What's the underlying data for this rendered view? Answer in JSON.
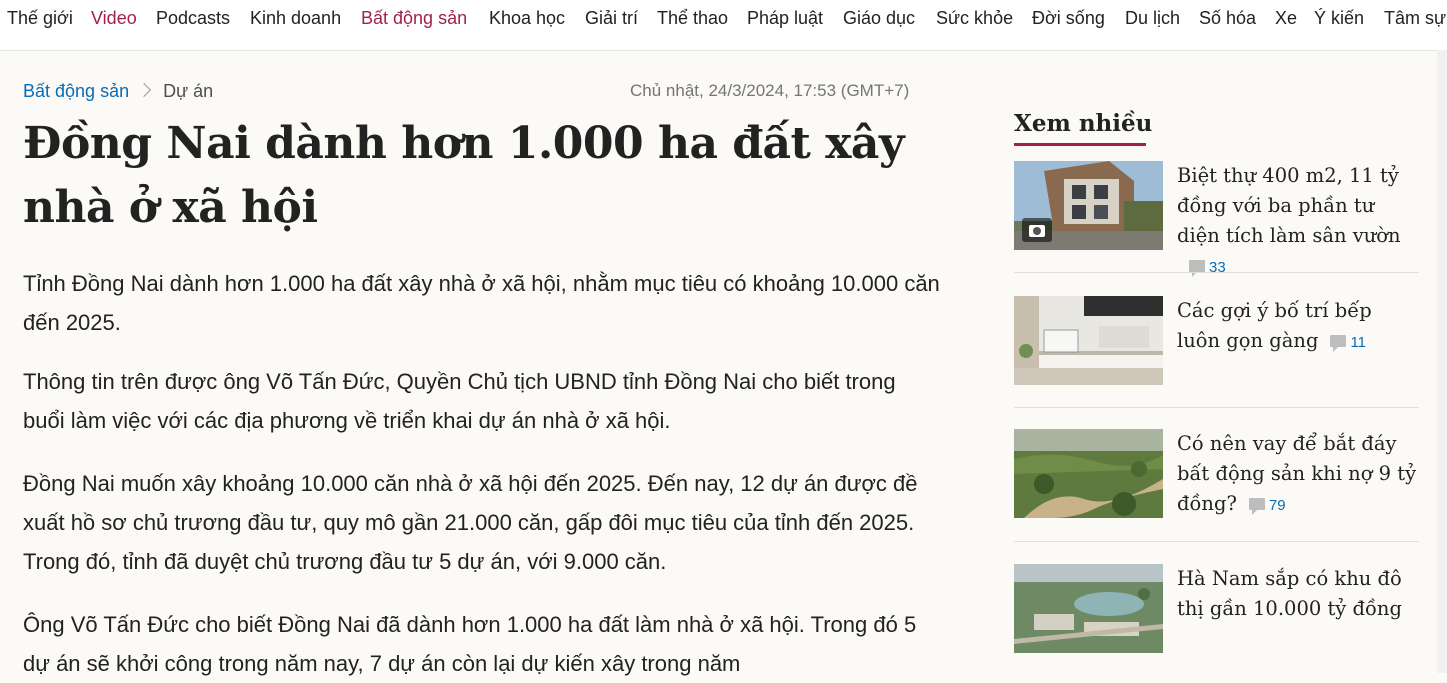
{
  "nav": {
    "items": [
      {
        "label": "Thế giới",
        "highlight": false
      },
      {
        "label": "Video",
        "highlight": true
      },
      {
        "label": "Podcasts",
        "highlight": false
      },
      {
        "label": "Kinh doanh",
        "highlight": false
      },
      {
        "label": "Bất động sản",
        "highlight": true
      },
      {
        "label": "Khoa học",
        "highlight": false
      },
      {
        "label": "Giải trí",
        "highlight": false
      },
      {
        "label": "Thể thao",
        "highlight": false
      },
      {
        "label": "Pháp luật",
        "highlight": false
      },
      {
        "label": "Giáo dục",
        "highlight": false
      },
      {
        "label": "Sức khỏe",
        "highlight": false
      },
      {
        "label": "Đời sống",
        "highlight": false
      },
      {
        "label": "Du lịch",
        "highlight": false
      },
      {
        "label": "Số hóa",
        "highlight": false
      },
      {
        "label": "Xe",
        "highlight": false
      },
      {
        "label": "Ý kiến",
        "highlight": false
      },
      {
        "label": "Tâm sự",
        "highlight": false
      }
    ]
  },
  "breadcrumb": {
    "section": "Bất động sản",
    "subsection": "Dự án"
  },
  "article": {
    "datetime": "Chủ nhật, 24/3/2024, 17:53 (GMT+7)",
    "title": "Đồng Nai dành hơn 1.000 ha đất xây nhà ở xã hội",
    "paragraphs": [
      "Tỉnh Đồng Nai dành hơn 1.000 ha đất xây nhà ở xã hội, nhằm mục tiêu có khoảng 10.000 căn đến 2025.",
      "Thông tin trên được ông Võ Tấn Đức, Quyền Chủ tịch UBND tỉnh Đồng Nai cho biết trong buổi làm việc với các địa phương về triển khai dự án nhà ở xã hội.",
      "Đồng Nai muốn xây khoảng 10.000 căn nhà ở xã hội đến 2025. Đến nay, 12 dự án được đề xuất hồ sơ chủ trương đầu tư, quy mô gần 21.000 căn, gấp đôi mục tiêu của tỉnh đến 2025. Trong đó, tỉnh đã duyệt chủ trương đầu tư 5 dự án, với 9.000 căn.",
      "Ông Võ Tấn Đức cho biết Đồng Nai đã dành hơn 1.000 ha đất làm nhà ở xã hội. Trong đó 5 dự án sẽ khởi công trong năm nay, 7 dự án còn lại dự kiến xây trong năm"
    ]
  },
  "sidebar": {
    "title": "Xem nhiều",
    "accent_color": "#9f224e",
    "items": [
      {
        "title": "Biệt thự 400 m2, 11 tỷ đồng với ba phần tư diện tích làm sân vườn",
        "comments": "33",
        "has_camera_icon": true
      },
      {
        "title": "Các gợi ý bố trí bếp luôn gọn gàng",
        "comments": "11",
        "has_camera_icon": false
      },
      {
        "title": "Có nên vay để bắt đáy bất động sản khi nợ 9 tỷ đồng?",
        "comments": "79",
        "has_camera_icon": false
      },
      {
        "title": "Hà Nam sắp có khu đô thị gần 10.000 tỷ đồng",
        "comments": "",
        "has_camera_icon": false
      }
    ]
  },
  "colors": {
    "accent": "#9f224e",
    "link": "#076db6",
    "background": "#fcfaf6"
  }
}
